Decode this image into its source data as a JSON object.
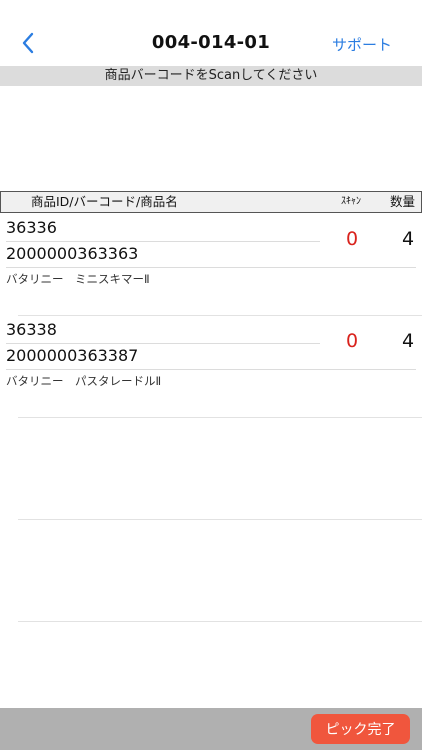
{
  "header": {
    "title": "004-014-01",
    "support_label": "サポート",
    "back_icon": "chevron-left-icon",
    "accent_color": "#2b7de1"
  },
  "instruction": "商品バーコードをScanしてください",
  "table": {
    "col_name": "商品ID/バーコード/商品名",
    "col_scan": "ｽｷｬﾝ",
    "col_qty": "数量"
  },
  "items": [
    {
      "id": "36336",
      "barcode": "2000000363363",
      "name": "バタリニー　ミニスキマーⅡ",
      "scan": "0",
      "qty": "4"
    },
    {
      "id": "36338",
      "barcode": "2000000363387",
      "name": "バタリニー　パスタレードルⅡ",
      "scan": "0",
      "qty": "4"
    }
  ],
  "footer": {
    "pick_complete_label": "ピック完了",
    "button_color": "#f0563d"
  }
}
